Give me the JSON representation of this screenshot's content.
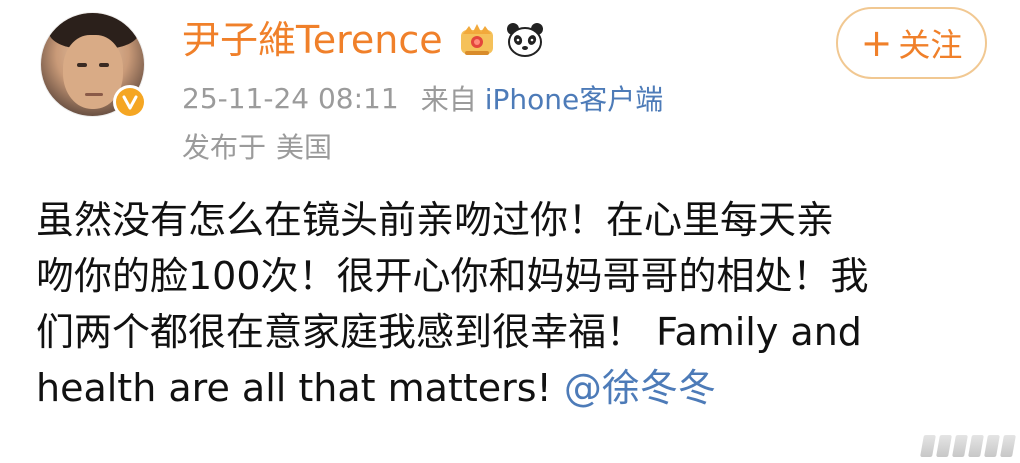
{
  "post": {
    "author": {
      "name": "尹子維Terence",
      "verified_icon": "verified-v-icon",
      "badge_icons": [
        "crown-icon",
        "panda-icon"
      ]
    },
    "meta": {
      "datetime": "25-11-24 08:11",
      "source_label": "来自",
      "source_app": "iPhone客户端"
    },
    "location": {
      "label": "发布于",
      "value": "美国"
    },
    "follow_button": {
      "plus": "+",
      "label": "关注"
    },
    "body": {
      "line1": "虽然没有怎么在镜头前亲吻过你！在心里每天亲",
      "line2": "吻你的脸100次！很开心你和妈妈哥哥的相处！我",
      "line3": "们两个都很在意家庭我感到很幸福！ Family and",
      "line4_text": "health are all that matters! ",
      "mention": "@徐冬冬"
    },
    "colors": {
      "username": "#f0802a",
      "link": "#4d7bb8",
      "meta": "#9b9b9b",
      "follow_border": "#f1c892"
    }
  }
}
